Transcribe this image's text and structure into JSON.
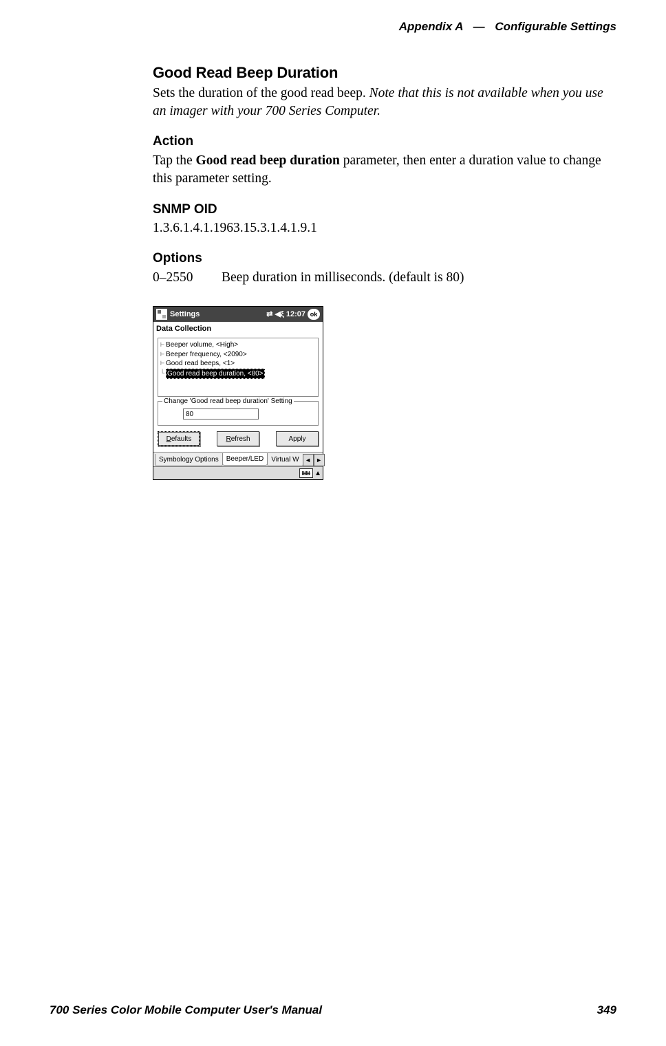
{
  "header": {
    "appendix": "Appendix A",
    "separator": "—",
    "title": "Configurable Settings"
  },
  "section": {
    "title": "Good Read Beep Duration",
    "intro_plain": "Sets the duration of the good read beep. ",
    "intro_italic": "Note that this is not available when you use an imager with your 700 Series Computer."
  },
  "action": {
    "heading": "Action",
    "pre": "Tap the ",
    "bold": "Good read beep duration",
    "post": " parameter, then enter a duration value to change this parameter setting."
  },
  "snmp": {
    "heading": "SNMP OID",
    "value": "1.3.6.1.4.1.1963.15.3.1.4.1.9.1"
  },
  "options": {
    "heading": "Options",
    "range": "0–2550",
    "desc": "Beep duration in milliseconds. (default is 80)"
  },
  "pda": {
    "title": "Settings",
    "time": "12:07",
    "ok": "ok",
    "panel": "Data Collection",
    "list": [
      "Beeper volume, <High>",
      "Beeper frequency, <2090>",
      "Good read beeps, <1>",
      "Good read beep duration, <80>"
    ],
    "group_title": "Change 'Good read beep duration' Setting",
    "input_value": "80",
    "buttons": {
      "defaults": "Defaults",
      "refresh": "Refresh",
      "apply": "Apply"
    },
    "tabs": {
      "t1": "Symbology Options",
      "t2": "Beeper/LED",
      "t3": "Virtual W"
    }
  },
  "footer": {
    "manual": "700 Series Color Mobile Computer User's Manual",
    "page": "349"
  }
}
